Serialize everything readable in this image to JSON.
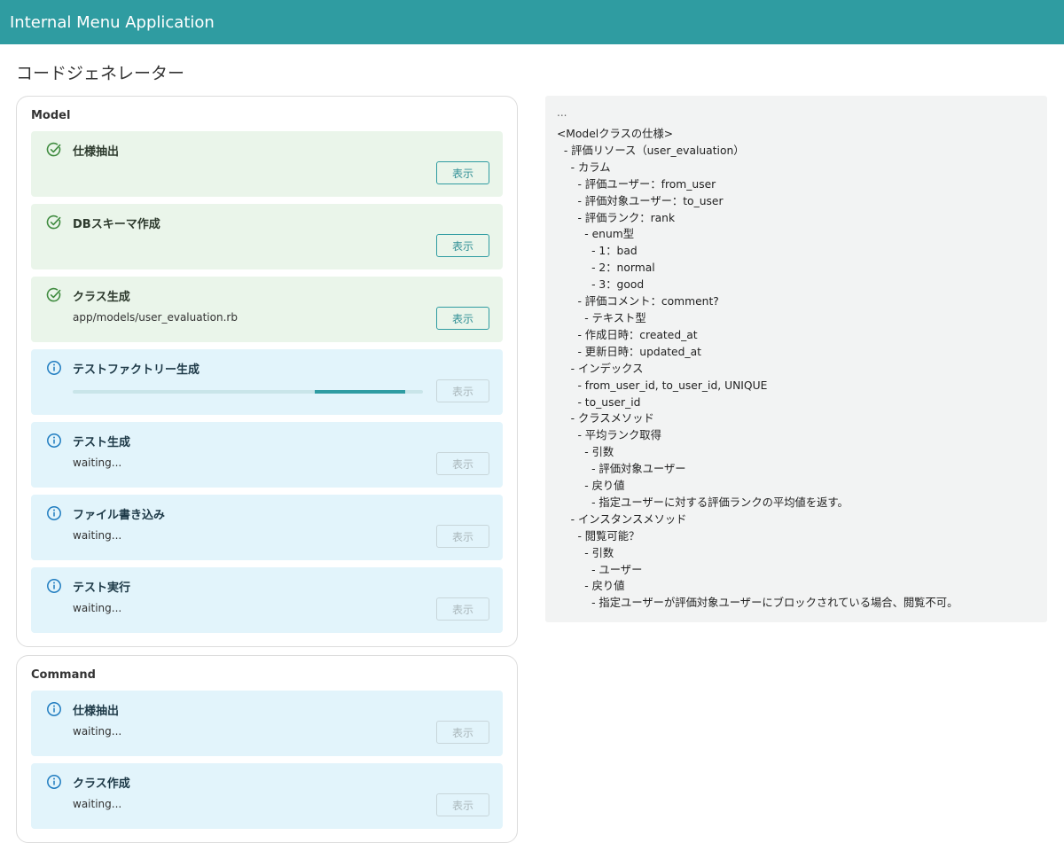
{
  "app_title": "Internal Menu Application",
  "page_title": "コードジェネレーター",
  "colors": {
    "appbar": "#2f9ca1",
    "success_bg": "#eaf5ea",
    "info_bg": "#e2f4fb",
    "success_icon": "#3f8b3f",
    "info_icon": "#1f7cc0"
  },
  "groups": [
    {
      "title": "Model",
      "steps": [
        {
          "status": "success",
          "icon": "check-circle-icon",
          "title": "仕様抽出",
          "sub": "",
          "button": "表示",
          "button_enabled": true
        },
        {
          "status": "success",
          "icon": "check-circle-icon",
          "title": "DBスキーマ作成",
          "sub": "",
          "button": "表示",
          "button_enabled": true
        },
        {
          "status": "success",
          "icon": "check-circle-icon",
          "title": "クラス生成",
          "sub": "app/models/user_evaluation.rb",
          "button": "表示",
          "button_enabled": true
        },
        {
          "status": "info",
          "icon": "info-circle-icon",
          "title": "テストファクトリー生成",
          "sub": "",
          "progress": {
            "start": 0.69,
            "end": 0.95
          },
          "button": "表示",
          "button_enabled": false
        },
        {
          "status": "info",
          "icon": "info-circle-icon",
          "title": "テスト生成",
          "sub": "waiting...",
          "button": "表示",
          "button_enabled": false
        },
        {
          "status": "info",
          "icon": "info-circle-icon",
          "title": "ファイル書き込み",
          "sub": "waiting...",
          "button": "表示",
          "button_enabled": false
        },
        {
          "status": "info",
          "icon": "info-circle-icon",
          "title": "テスト実行",
          "sub": "waiting...",
          "button": "表示",
          "button_enabled": false
        }
      ]
    },
    {
      "title": "Command",
      "steps": [
        {
          "status": "info",
          "icon": "info-circle-icon",
          "title": "仕様抽出",
          "sub": "waiting...",
          "button": "表示",
          "button_enabled": false
        },
        {
          "status": "info",
          "icon": "info-circle-icon",
          "title": "クラス作成",
          "sub": "waiting...",
          "button": "表示",
          "button_enabled": false
        }
      ]
    }
  ],
  "spec_panel": {
    "header": "...",
    "lines": [
      "<Modelクラスの仕様>",
      "  - 評価リソース（user_evaluation）",
      "    - カラム",
      "      - 評価ユーザー：from_user",
      "      - 評価対象ユーザー：to_user",
      "      - 評価ランク：rank",
      "        - enum型",
      "          - 1：bad",
      "          - 2：normal",
      "          - 3：good",
      "      - 評価コメント：comment?",
      "        - テキスト型",
      "      - 作成日時：created_at",
      "      - 更新日時：updated_at",
      "    - インデックス",
      "      - from_user_id, to_user_id, UNIQUE",
      "      - to_user_id",
      "    - クラスメソッド",
      "      - 平均ランク取得",
      "        - 引数",
      "          - 評価対象ユーザー",
      "        - 戻り値",
      "          - 指定ユーザーに対する評価ランクの平均値を返す。",
      "    - インスタンスメソッド",
      "      - 閲覧可能？",
      "        - 引数",
      "          - ユーザー",
      "        - 戻り値",
      "          - 指定ユーザーが評価対象ユーザーにブロックされている場合、閲覧不可。"
    ]
  }
}
